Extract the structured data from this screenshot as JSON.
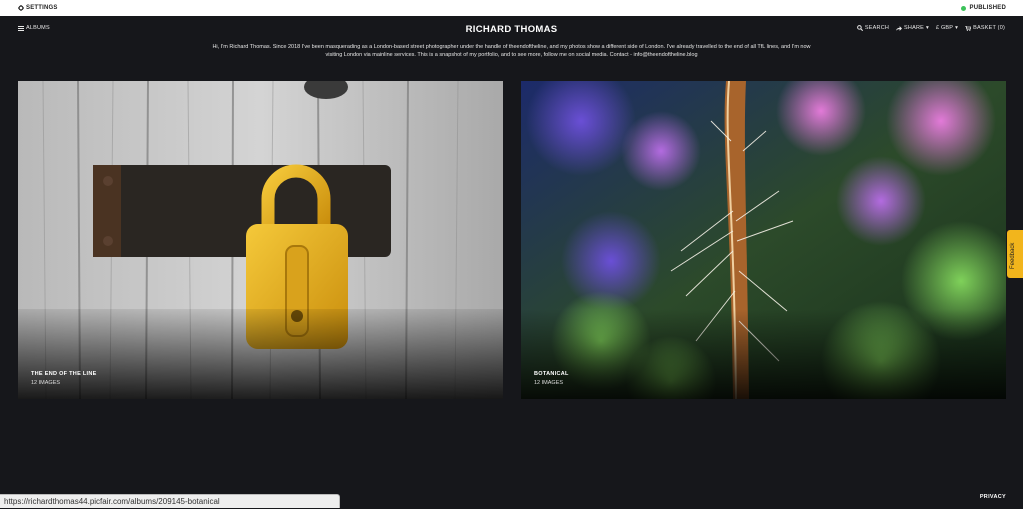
{
  "topbar": {
    "settings_label": "SETTINGS",
    "published_label": "PUBLISHED"
  },
  "nav": {
    "albums_label": "ALBUMS",
    "search_label": "SEARCH",
    "share_label": "SHARE",
    "currency_label": "£ GBP",
    "basket_label": "BASKET (0)"
  },
  "site": {
    "title": "RICHARD THOMAS",
    "intro_line1": "Hi, I'm Richard Thomas. Since 2018 I've been masquerading as a London-based street photographer under the handle of theendoftheline, and my photos show a different side of London. I've already travelled to the end of all TfL lines, and I'm now",
    "intro_line2": "visiting London via mainline services. This is a snapshot of my portfolio, and to see more, follow me on social media. Contact - info@theendoftheline.blog"
  },
  "albums": [
    {
      "title": "THE END OF THE LINE",
      "count": "12 IMAGES"
    },
    {
      "title": "BOTANICAL",
      "count": "12 IMAGES"
    }
  ],
  "feedback_label": "Feedback",
  "status_url": "https://richardthomas44.picfair.com/albums/209145-botanical",
  "footer": {
    "privacy_label": "PRIVACY"
  },
  "colors": {
    "background": "#16171b",
    "published_dot": "#3cc25a",
    "feedback_tab": "#f2b51c",
    "padlock": "#e8b21a"
  }
}
